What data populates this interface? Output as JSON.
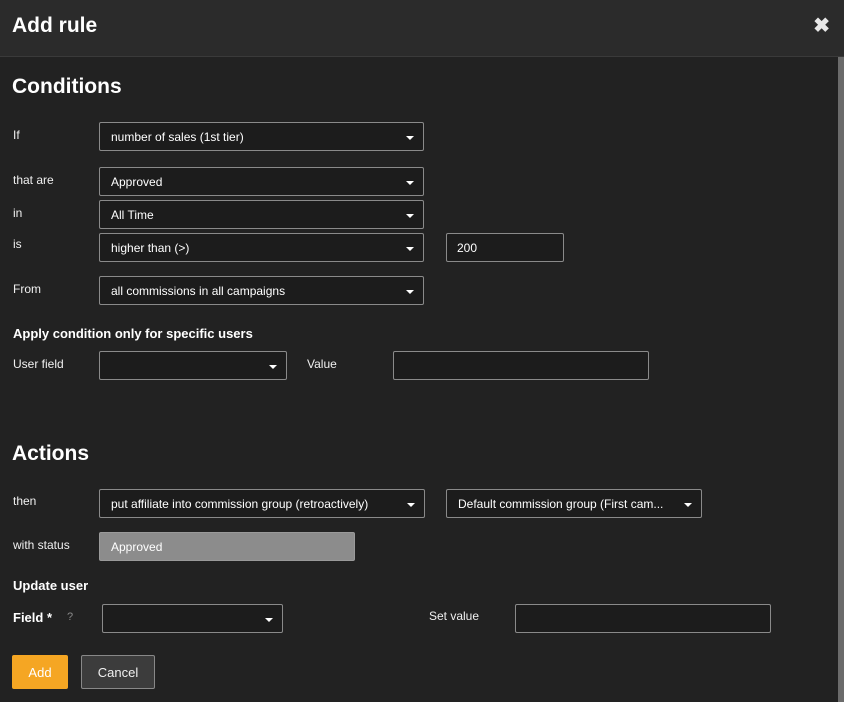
{
  "dialog": {
    "title": "Add rule",
    "close_glyph": "✖"
  },
  "conditions": {
    "heading": "Conditions",
    "if_label": "If",
    "if_value": "number of sales (1st tier)",
    "that_are_label": "that are",
    "that_are_value": "Approved",
    "in_label": "in",
    "in_value": "All Time",
    "is_label": "is",
    "is_value": "higher than (>)",
    "is_amount": "200",
    "from_label": "From",
    "from_value": "all commissions in all campaigns",
    "specific_heading": "Apply condition only for specific users",
    "user_field_label": "User field",
    "user_field_value": "",
    "value_label": "Value",
    "value_input": ""
  },
  "actions": {
    "heading": "Actions",
    "then_label": "then",
    "then_value": "put affiliate into commission group (retroactively)",
    "group_value": "Default commission group (First cam...",
    "with_status_label": "with status",
    "with_status_value": "Approved",
    "update_user_heading": "Update user",
    "field_label": "Field",
    "field_required": "*",
    "field_help": "?",
    "field_value": "",
    "set_value_label": "Set value",
    "set_value_input": ""
  },
  "buttons": {
    "add": "Add",
    "cancel": "Cancel"
  },
  "colors": {
    "accent": "#f5a623",
    "background": "#222222",
    "titlebar": "#2b2b2b"
  },
  "icons": {
    "close": "close-icon",
    "caret": "chevron-down-icon"
  }
}
